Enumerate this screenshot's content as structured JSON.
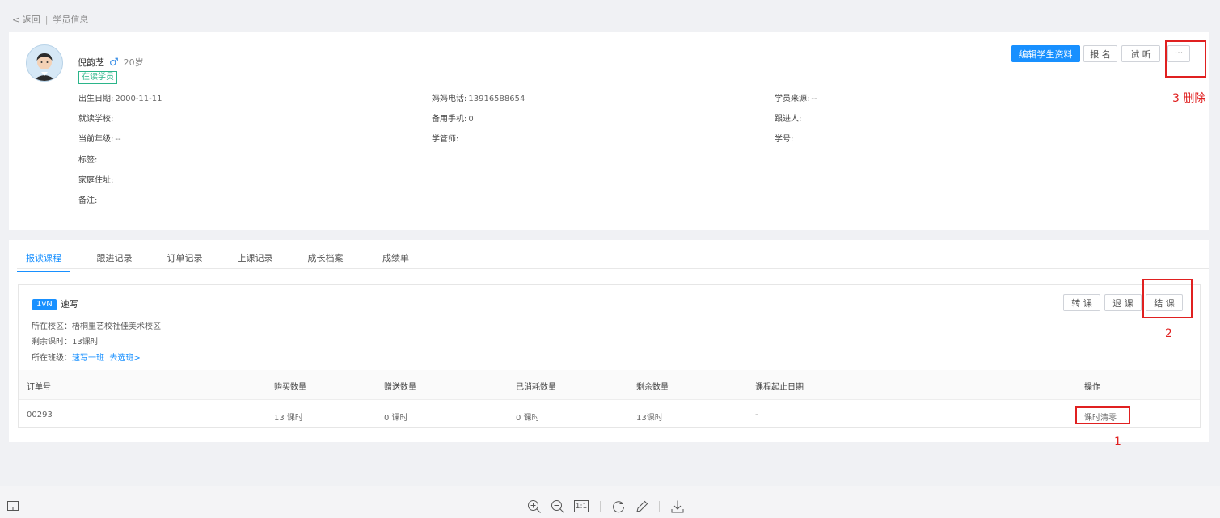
{
  "breadcrumb": {
    "back": "< 返回",
    "current": "学员信息"
  },
  "student": {
    "name": "倪韵芝",
    "gender_symbol": "♂",
    "age": "20岁",
    "status": "在读学员"
  },
  "fields": {
    "birth": {
      "label": "出生日期:",
      "value": "2000-11-11"
    },
    "school": {
      "label": "就读学校:",
      "value": ""
    },
    "grade": {
      "label": "当前年级:",
      "value": "--"
    },
    "tags": {
      "label": "标签:",
      "value": ""
    },
    "address": {
      "label": "家庭住址:",
      "value": ""
    },
    "remark": {
      "label": "备注:",
      "value": ""
    },
    "mom_phone": {
      "label": "妈妈电话:",
      "value": "13916588654"
    },
    "backup_phone": {
      "label": "备用手机:",
      "value": "0"
    },
    "manager": {
      "label": "学管师:",
      "value": ""
    },
    "source": {
      "label": "学员来源:",
      "value": "--"
    },
    "follower": {
      "label": "跟进人:",
      "value": ""
    },
    "student_no": {
      "label": "学号:",
      "value": ""
    }
  },
  "actions": {
    "edit": "编辑学生资料",
    "enroll": "报 名",
    "trial": "试 听",
    "more": "···"
  },
  "annotations": {
    "a1": "1",
    "a2": "2",
    "a3": "3 删除"
  },
  "tabs": [
    "报读课程",
    "跟进记录",
    "订单记录",
    "上课记录",
    "成长档案",
    "成绩单"
  ],
  "course": {
    "badge": "1vN",
    "name": "速写",
    "campus": "所在校区：梧桐里艺校社佳美术校区",
    "remaining": "剩余课时：13课时",
    "class_label": "所在班级：",
    "class_name": "速写一班",
    "choose_class": "去选班>",
    "buttons": {
      "transfer": "转 课",
      "refund": "退 课",
      "finish": "结 课"
    }
  },
  "table": {
    "headers": [
      "订单号",
      "购买数量",
      "赠送数量",
      "已消耗数量",
      "剩余数量",
      "课程起止日期",
      "操作"
    ],
    "rows": [
      {
        "order": "00293",
        "bought": "13 课时",
        "gift": "0 课时",
        "used": "0 课时",
        "remain": "13课时",
        "dates": "-",
        "op": "课时清零"
      }
    ]
  },
  "colors": {
    "primary": "#1890ff",
    "annotation": "#e02020",
    "status_tag": "#2bb58a"
  },
  "toolbar_icons": [
    "panel-icon",
    "zoom-in-icon",
    "zoom-out-icon",
    "actual-size-icon",
    "rotate-icon",
    "pen-icon",
    "download-icon"
  ],
  "toolbar": {
    "actual_size": "1:1"
  }
}
